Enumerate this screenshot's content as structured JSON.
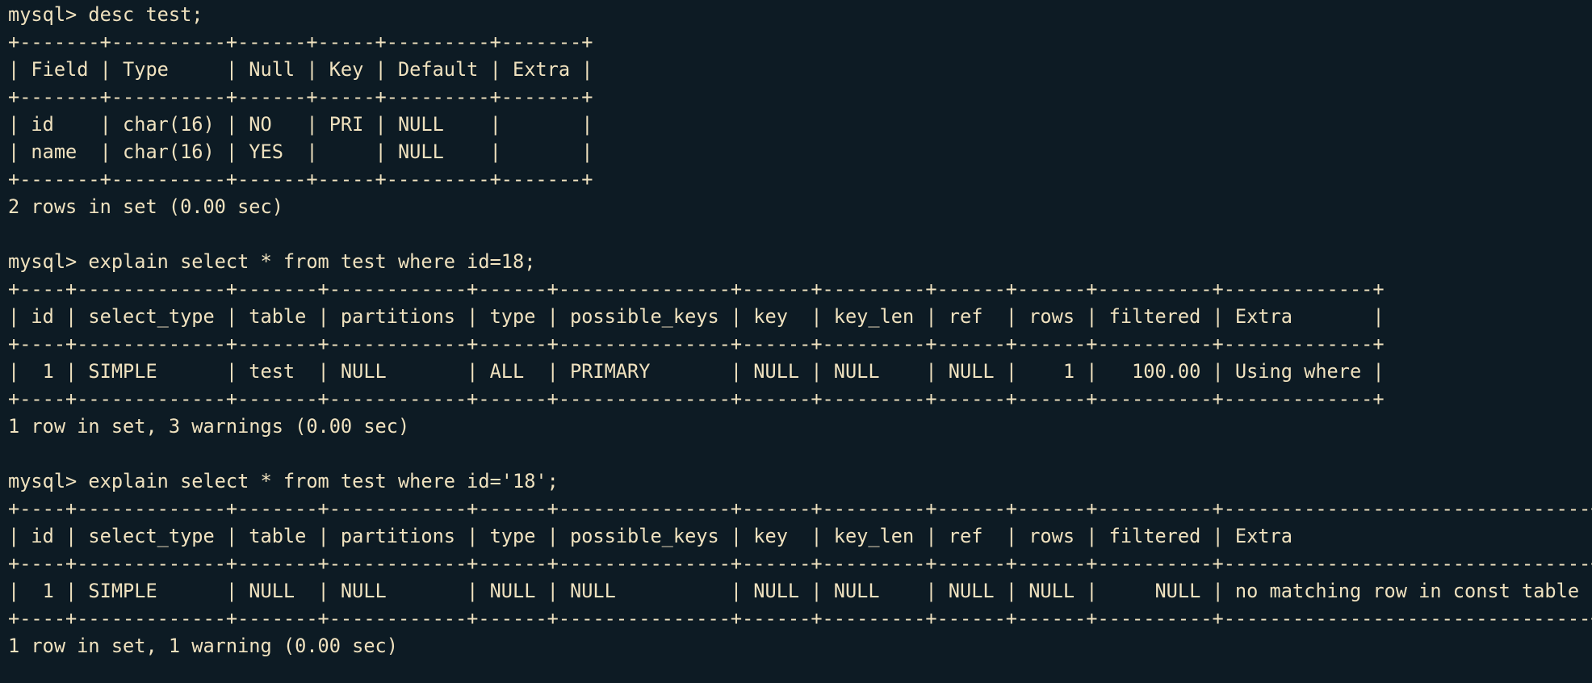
{
  "terminal": {
    "lines": [
      "mysql> desc test;",
      "+-------+----------+------+-----+---------+-------+",
      "| Field | Type     | Null | Key | Default | Extra |",
      "+-------+----------+------+-----+---------+-------+",
      "| id    | char(16) | NO   | PRI | NULL    |       |",
      "| name  | char(16) | YES  |     | NULL    |       |",
      "+-------+----------+------+-----+---------+-------+",
      "2 rows in set (0.00 sec)",
      "",
      "mysql> explain select * from test where id=18;",
      "+----+-------------+-------+------------+------+---------------+------+---------+------+------+----------+-------------+",
      "| id | select_type | table | partitions | type | possible_keys | key  | key_len | ref  | rows | filtered | Extra       |",
      "+----+-------------+-------+------------+------+---------------+------+---------+------+------+----------+-------------+",
      "|  1 | SIMPLE      | test  | NULL       | ALL  | PRIMARY       | NULL | NULL    | NULL |    1 |   100.00 | Using where |",
      "+----+-------------+-------+------------+------+---------------+------+---------+------+------+----------+-------------+",
      "1 row in set, 3 warnings (0.00 sec)",
      "",
      "mysql> explain select * from test where id='18';",
      "+----+-------------+-------+------------+------+---------------+------+---------+------+------+----------+--------------------------------+",
      "| id | select_type | table | partitions | type | possible_keys | key  | key_len | ref  | rows | filtered | Extra                          |",
      "+----+-------------+-------+------------+------+---------------+------+---------+------+------+----------+--------------------------------+",
      "|  1 | SIMPLE      | NULL  | NULL       | NULL | NULL          | NULL | NULL    | NULL | NULL |     NULL | no matching row in const table |",
      "+----+-------------+-------+------------+------+---------------+------+---------+------+------+----------+--------------------------------+",
      "1 row in set, 1 warning (0.00 sec)"
    ]
  }
}
